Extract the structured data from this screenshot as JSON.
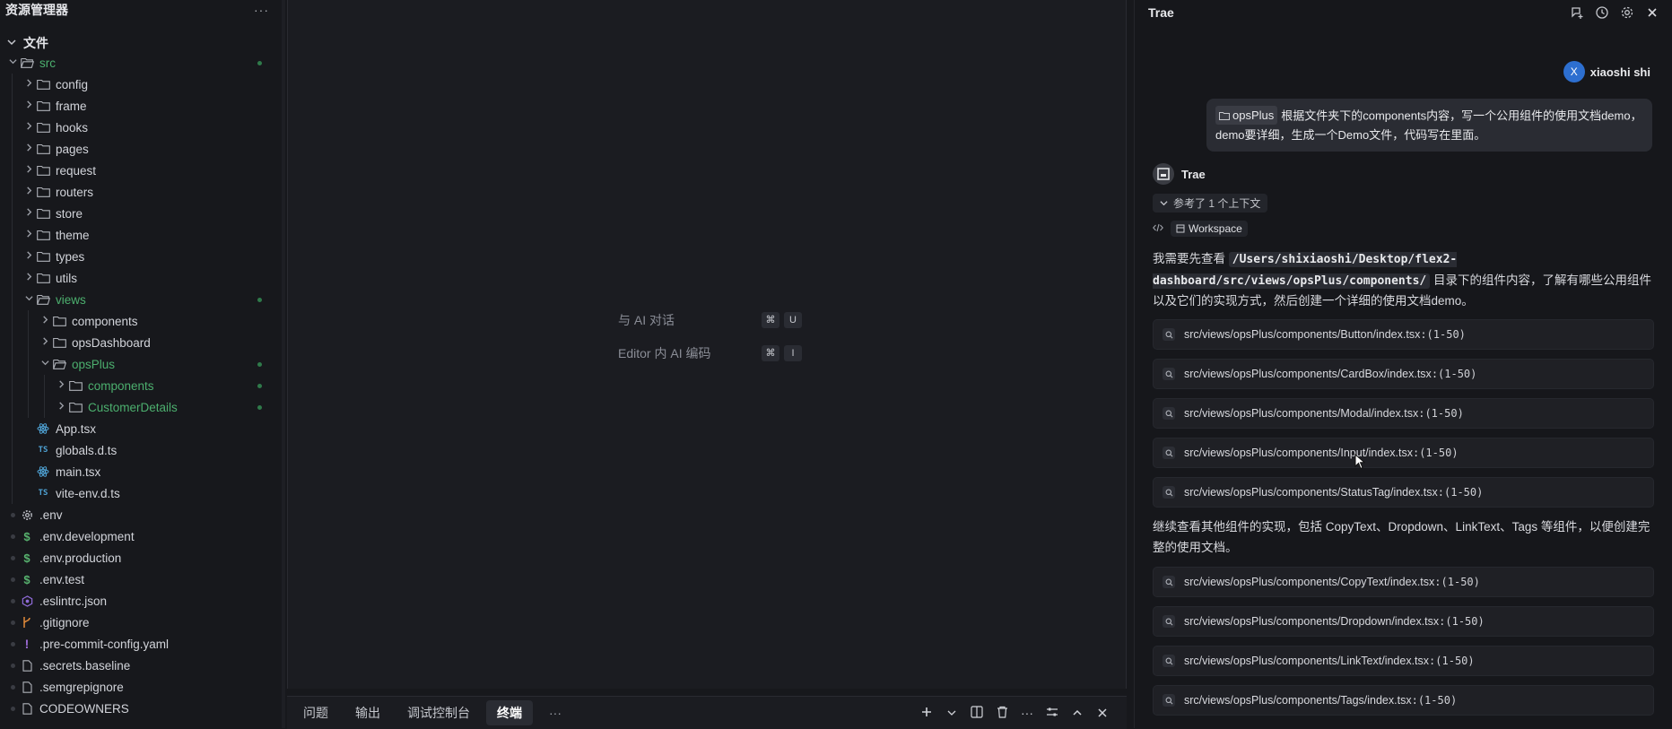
{
  "explorer": {
    "title": "资源管理器",
    "more": "···",
    "section": "文件",
    "items": [
      {
        "label": "src",
        "chevron": "open",
        "icon": "folder-open",
        "depth": 0,
        "green": true,
        "dot": true
      },
      {
        "label": "config",
        "chevron": "closed",
        "icon": "folder",
        "depth": 1
      },
      {
        "label": "frame",
        "chevron": "closed",
        "icon": "folder",
        "depth": 1
      },
      {
        "label": "hooks",
        "chevron": "closed",
        "icon": "folder",
        "depth": 1
      },
      {
        "label": "pages",
        "chevron": "closed",
        "icon": "folder",
        "depth": 1
      },
      {
        "label": "request",
        "chevron": "closed",
        "icon": "folder",
        "depth": 1
      },
      {
        "label": "routers",
        "chevron": "closed",
        "icon": "folder",
        "depth": 1
      },
      {
        "label": "store",
        "chevron": "closed",
        "icon": "folder",
        "depth": 1
      },
      {
        "label": "theme",
        "chevron": "closed",
        "icon": "folder",
        "depth": 1
      },
      {
        "label": "types",
        "chevron": "closed",
        "icon": "folder",
        "depth": 1
      },
      {
        "label": "utils",
        "chevron": "closed",
        "icon": "folder",
        "depth": 1
      },
      {
        "label": "views",
        "chevron": "open",
        "icon": "folder-open",
        "depth": 1,
        "green": true,
        "dot": true
      },
      {
        "label": "components",
        "chevron": "closed",
        "icon": "folder",
        "depth": 2
      },
      {
        "label": "opsDashboard",
        "chevron": "closed",
        "icon": "folder",
        "depth": 2
      },
      {
        "label": "opsPlus",
        "chevron": "open",
        "icon": "folder-open",
        "depth": 2,
        "green": true,
        "dot": true
      },
      {
        "label": "components",
        "chevron": "closed",
        "icon": "folder",
        "depth": 3,
        "green": true,
        "dot": true
      },
      {
        "label": "CustomerDetails",
        "chevron": "closed",
        "icon": "folder",
        "depth": 3,
        "green": true,
        "dot": true
      },
      {
        "label": "App.tsx",
        "chevron": "none",
        "icon": "react",
        "depth": 1
      },
      {
        "label": "globals.d.ts",
        "chevron": "none",
        "icon": "ts",
        "depth": 1
      },
      {
        "label": "main.tsx",
        "chevron": "none",
        "icon": "react",
        "depth": 1
      },
      {
        "label": "vite-env.d.ts",
        "chevron": "none",
        "icon": "ts",
        "depth": 1
      },
      {
        "label": ".env",
        "chevron": "none",
        "icon": "gear",
        "depth": 0
      },
      {
        "label": ".env.development",
        "chevron": "none",
        "icon": "dollar",
        "depth": 0
      },
      {
        "label": ".env.production",
        "chevron": "none",
        "icon": "dollar",
        "depth": 0
      },
      {
        "label": ".env.test",
        "chevron": "none",
        "icon": "dollar",
        "depth": 0
      },
      {
        "label": ".eslintrc.json",
        "chevron": "none",
        "icon": "eslint",
        "depth": 0
      },
      {
        "label": ".gitignore",
        "chevron": "none",
        "icon": "git",
        "depth": 0
      },
      {
        "label": ".pre-commit-config.yaml",
        "chevron": "none",
        "icon": "exclaim",
        "depth": 0
      },
      {
        "label": ".secrets.baseline",
        "chevron": "none",
        "icon": "file",
        "depth": 0
      },
      {
        "label": ".semgrepignore",
        "chevron": "none",
        "icon": "file",
        "depth": 0
      },
      {
        "label": "CODEOWNERS",
        "chevron": "none",
        "icon": "file",
        "depth": 0
      }
    ]
  },
  "editor": {
    "hints": [
      {
        "label": "与 AI 对话",
        "keys": [
          "⌘",
          "U"
        ]
      },
      {
        "label": "Editor 内 AI 编码",
        "keys": [
          "⌘",
          "I"
        ]
      }
    ]
  },
  "panel": {
    "tabs": [
      "问题",
      "输出",
      "调试控制台",
      "终端"
    ],
    "active_tab": "终端",
    "more": "···"
  },
  "ai": {
    "title": "Trae",
    "user_name": "xiaoshi shi",
    "user_initial": "X",
    "user_chip": "opsPlus",
    "user_message": "根据文件夹下的components内容，写一个公用组件的使用文档demo，demo要详细，生成一个Demo文件，代码写在里面。",
    "assistant_name": "Trae",
    "ref_label": "参考了 1 个上下文",
    "workspace_label": "Workspace",
    "para1_before": "我需要先查看 ",
    "para1_code": "/Users/shixiaoshi/Desktop/flex2-dashboard/src/views/opsPlus/components/",
    "para1_after": " 目录下的组件内容，了解有哪些公用组件以及它们的实现方式，然后创建一个详细的使用文档demo。",
    "files1": [
      {
        "path": "src/views/opsPlus/components/Button/index.tsx",
        "range": ":(1-50)"
      },
      {
        "path": "src/views/opsPlus/components/CardBox/index.tsx",
        "range": ":(1-50)"
      },
      {
        "path": "src/views/opsPlus/components/Modal/index.tsx",
        "range": ":(1-50)"
      },
      {
        "path": "src/views/opsPlus/components/Input/index.tsx",
        "range": ":(1-50)"
      },
      {
        "path": "src/views/opsPlus/components/StatusTag/index.tsx",
        "range": ":(1-50)"
      }
    ],
    "para2": "继续查看其他组件的实现，包括 CopyText、Dropdown、LinkText、Tags 等组件，以便创建完整的使用文档。",
    "files2": [
      {
        "path": "src/views/opsPlus/components/CopyText/index.tsx",
        "range": ":(1-50)"
      },
      {
        "path": "src/views/opsPlus/components/Dropdown/index.tsx",
        "range": ":(1-50)"
      },
      {
        "path": "src/views/opsPlus/components/LinkText/index.tsx",
        "range": ":(1-50)"
      },
      {
        "path": "src/views/opsPlus/components/Tags/index.tsx",
        "range": ":(1-50)"
      }
    ]
  },
  "colors": {
    "green": "#4caf6e",
    "accent_blue": "#2d6fd0",
    "bg": "#17181c"
  }
}
